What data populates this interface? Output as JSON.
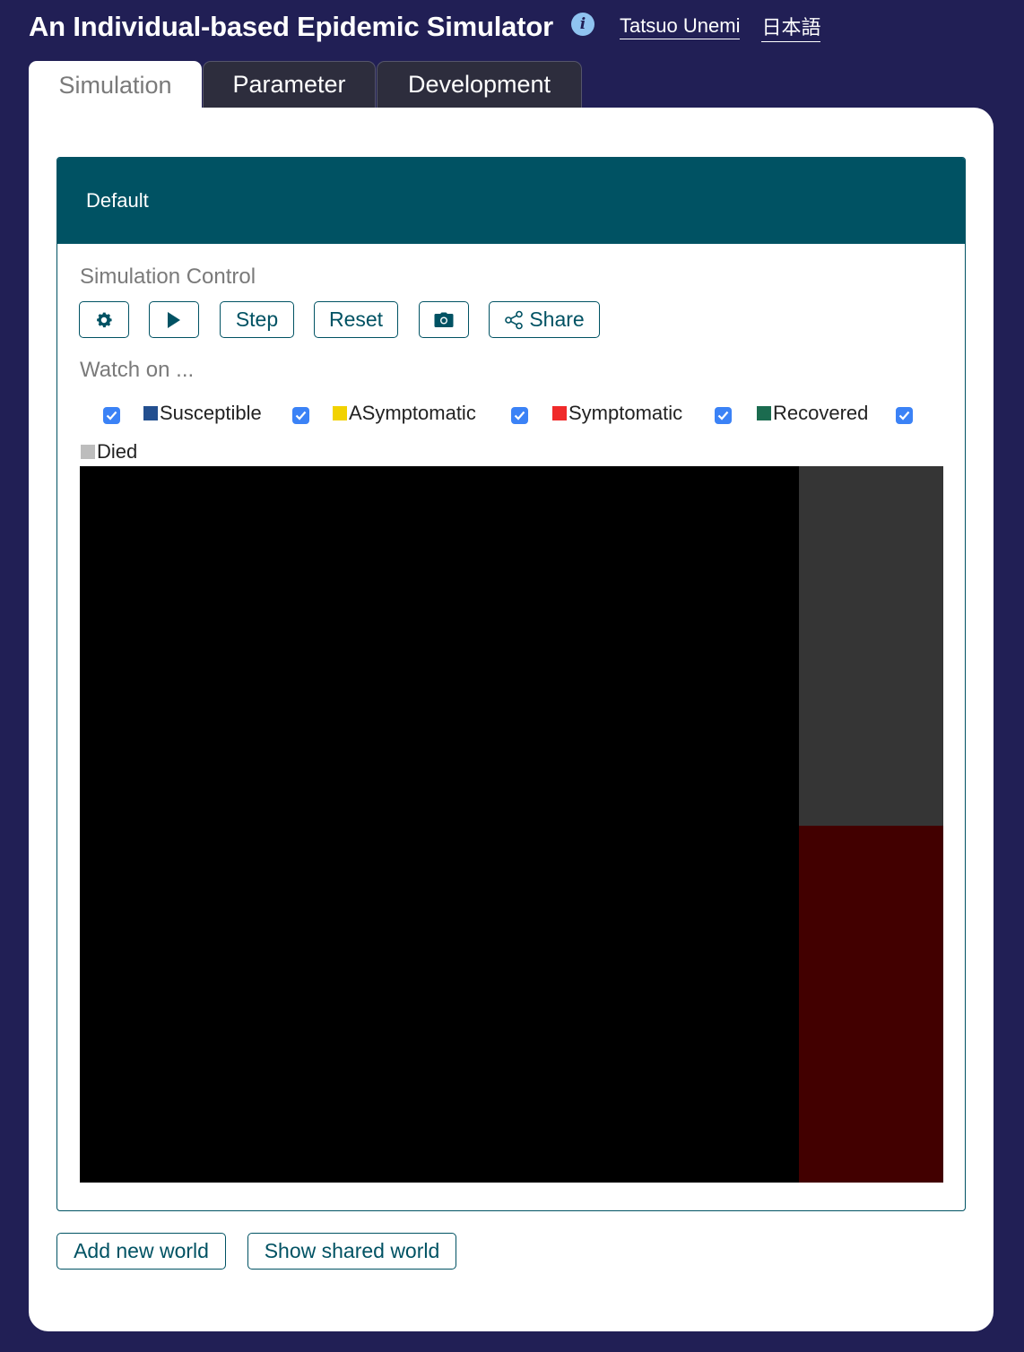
{
  "header": {
    "title": "An Individual-based Epidemic Simulator",
    "info_icon": "i",
    "author_link": "Tatsuo Unemi",
    "language_link": "日本語"
  },
  "tabs": [
    {
      "label": "Simulation",
      "active": true
    },
    {
      "label": "Parameter",
      "active": false
    },
    {
      "label": "Development",
      "active": false
    }
  ],
  "world": {
    "name": "Default",
    "control_label": "Simulation Control",
    "buttons": {
      "settings_icon": "gear-icon",
      "play_icon": "play-icon",
      "step": "Step",
      "reset": "Reset",
      "snapshot_icon": "camera-icon",
      "share": "Share"
    },
    "watch_label": "Watch on ...",
    "watch_items": [
      {
        "label": "Susceptible",
        "color": "#234f8f",
        "checked": true
      },
      {
        "label": "ASymptomatic",
        "color": "#f2d200",
        "checked": true
      },
      {
        "label": "Symptomatic",
        "color": "#f02a2a",
        "checked": true
      },
      {
        "label": "Recovered",
        "color": "#1b6b4f",
        "checked": true
      },
      {
        "label": "Died",
        "color": "#bdbdbd",
        "checked": true
      }
    ]
  },
  "footer": {
    "add_world": "Add new world",
    "show_shared": "Show shared world"
  },
  "colors": {
    "background": "#211f55",
    "accent": "#005263",
    "checkbox": "#3b82f6"
  }
}
